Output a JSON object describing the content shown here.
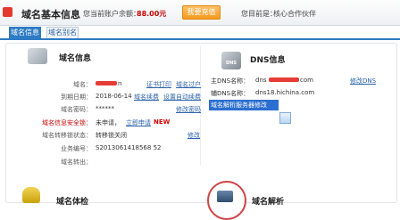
{
  "header": {
    "title": "域名基本信息",
    "balance_label": "您当前账户余额：",
    "balance_value": "88.00元",
    "recharge_label": "我要充值",
    "identity_label": "您目前是：",
    "identity_value": "核心合作伙伴"
  },
  "tabs": {
    "active": "域名信息",
    "inactive": "域名别名"
  },
  "domain_info": {
    "title": "域名信息",
    "rows": {
      "domain_label": "域名：",
      "domain_value_suffix": "n",
      "expiry_label": "到期日期：",
      "expiry_value": "2018-06-14",
      "password_label": "域名密码：",
      "password_value": "******",
      "security_label": "域名信息安全锁：",
      "security_value": "未申请，",
      "security_link": "立即申请",
      "security_new": "NEW",
      "transfer_label": "域名转移锁状态：",
      "transfer_value": "转移锁关闭",
      "business_label": "业务编号：",
      "business_value": "S2013061418568 52",
      "outbound_label": "域名转出："
    },
    "links": {
      "cert_print": "证书打印",
      "domain_transfer": "域名过户",
      "domain_renew": "域名续费",
      "auto_renew": "设置自动续费",
      "change_password": "修改密码",
      "modify": "修改"
    }
  },
  "dns_info": {
    "title": "DNS信息",
    "primary_label": "主DNS名称：",
    "primary_prefix": "dns",
    "primary_suffix": "com",
    "secondary_label": "辅DNS名称：",
    "secondary_value": "dns18.hichina.com",
    "modify_link": "修改DNS",
    "selected_text": "域名解析服务器修改"
  },
  "bottom": {
    "left_title": "域名体检",
    "right_title": "域名解析"
  },
  "colors": {
    "accent_blue": "#2d7bc4",
    "link_blue": "#2b62a8",
    "alert_red": "#c40000",
    "button_orange": "#f39a1e"
  }
}
